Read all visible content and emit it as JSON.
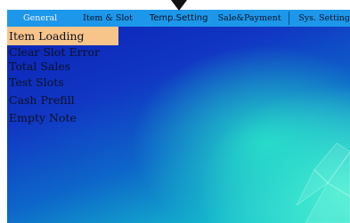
{
  "menubar": {
    "tabs": [
      {
        "label": "General"
      },
      {
        "label": "Item & Slot"
      },
      {
        "label": "Temp.Setting"
      },
      {
        "label": "Sale&Payment"
      },
      {
        "label": "Sys. Setting"
      }
    ]
  },
  "menu": {
    "items": [
      {
        "label": "Item Loading"
      },
      {
        "label": "Clear Slot Error"
      },
      {
        "label": "Total Sales"
      },
      {
        "label": "Test Slots"
      },
      {
        "label": "Cash Prefill"
      },
      {
        "label": "Empty Note"
      }
    ],
    "selected": "Item Loading"
  },
  "colors": {
    "menubar": "#1d97ea",
    "selected_item": "#f7c48a",
    "text": "#0c1222"
  },
  "icons": {
    "indicator": "down-arrow-indicator-icon"
  }
}
